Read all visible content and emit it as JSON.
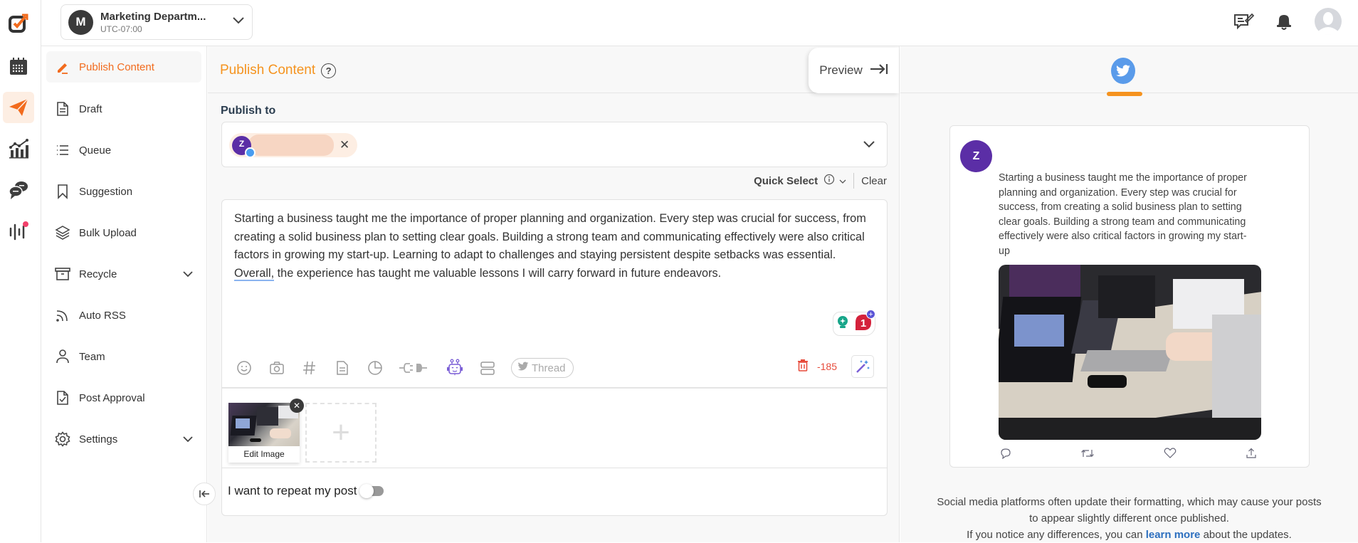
{
  "workspace": {
    "avatar_letter": "M",
    "name": "Marketing Departm...",
    "timezone": "UTC-07:00"
  },
  "rail": {
    "items": [
      {
        "icon": "logo-icon"
      },
      {
        "icon": "calendar-icon"
      },
      {
        "icon": "paper-plane-icon",
        "active": true
      },
      {
        "icon": "analytics-icon"
      },
      {
        "icon": "chat-icon"
      },
      {
        "icon": "audio-wave-icon",
        "notification": true
      }
    ]
  },
  "topbar": {
    "icons": [
      "feedback-icon",
      "bell-icon",
      "profile-avatar"
    ]
  },
  "sidebar": {
    "items": [
      {
        "label": "Publish Content",
        "icon": "pencil-icon",
        "active": true
      },
      {
        "label": "Draft",
        "icon": "document-icon"
      },
      {
        "label": "Queue",
        "icon": "list-icon"
      },
      {
        "label": "Suggestion",
        "icon": "bookmark-icon"
      },
      {
        "label": "Bulk Upload",
        "icon": "layers-icon"
      },
      {
        "label": "Recycle",
        "icon": "archive-icon",
        "expandable": true
      },
      {
        "label": "Auto RSS",
        "icon": "rss-icon"
      },
      {
        "label": "Team",
        "icon": "user-icon"
      },
      {
        "label": "Post Approval",
        "icon": "file-check-icon"
      },
      {
        "label": "Settings",
        "icon": "gear-icon",
        "expandable": true
      }
    ]
  },
  "main": {
    "title": "Publish Content",
    "preview_label": "Preview",
    "publish_to_label": "Publish to",
    "account_chip": {
      "avatar_letter": "Z",
      "network": "twitter"
    },
    "quick_select_label": "Quick Select",
    "clear_label": "Clear",
    "post_text_before": "Starting a business taught me the importance of proper planning and organization. Every step was crucial for success, from creating a solid business plan to setting clear goals. Building a strong team and communicating effectively were also critical factors in growing my start-up. Learning to adapt to challenges and staying persistent despite setbacks was essential. ",
    "post_text_underlined": "Overall,",
    "post_text_after": " the experience has taught me valuable lessons I will carry forward in future endeavors.",
    "grammar_count": "1",
    "toolbar_icons": [
      "emoji-icon",
      "camera-icon",
      "hashtag-icon",
      "document-icon",
      "pie-chart-icon",
      "plug-icon",
      "robot-icon",
      "split-icon"
    ],
    "thread_label": "Thread",
    "char_count": "-185",
    "edit_image_label": "Edit Image",
    "repeat_label": "I want to repeat my post",
    "repeat_enabled": false
  },
  "preview": {
    "active_network": "twitter",
    "avatar_letter": "Z",
    "text": "Starting a business taught me the importance of proper planning and organization. Every step was crucial for success, from creating a solid business plan to setting clear goals. Building a strong team and communicating effectively were also critical factors in growing my start-up",
    "actions": [
      "reply-icon",
      "retweet-icon",
      "like-icon",
      "share-icon"
    ],
    "note_line1": "Social media platforms often update their formatting, which may cause your posts",
    "note_line2": "to appear slightly different once published.",
    "note_line3_before": "If you notice any differences, you can ",
    "note_link": "learn more",
    "note_line3_after": " about the updates."
  },
  "colors": {
    "accent": "#f26b1d",
    "title_orange": "#f5931f",
    "twitter_blue": "#5a9bea",
    "avatar_purple": "#5b2ea6",
    "danger": "#e74c3c"
  }
}
